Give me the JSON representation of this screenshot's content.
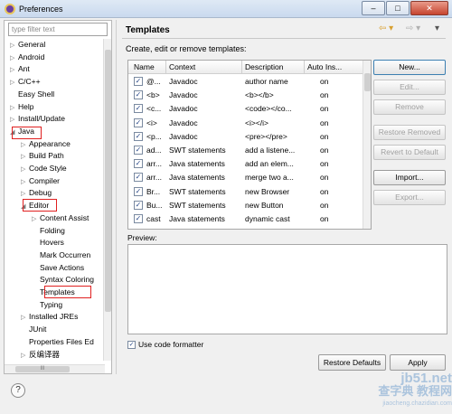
{
  "window": {
    "title": "Preferences",
    "min": "–",
    "max": "□",
    "close": "✕"
  },
  "sidebar": {
    "filter_placeholder": "type filter text",
    "items": [
      {
        "label": "General",
        "indent": 0,
        "twisty": "▷"
      },
      {
        "label": "Android",
        "indent": 0,
        "twisty": "▷"
      },
      {
        "label": "Ant",
        "indent": 0,
        "twisty": "▷"
      },
      {
        "label": "C/C++",
        "indent": 0,
        "twisty": "▷"
      },
      {
        "label": "Easy Shell",
        "indent": 0,
        "twisty": ""
      },
      {
        "label": "Help",
        "indent": 0,
        "twisty": "▷"
      },
      {
        "label": "Install/Update",
        "indent": 0,
        "twisty": "▷"
      },
      {
        "label": "Java",
        "indent": 0,
        "twisty": "◢"
      },
      {
        "label": "Appearance",
        "indent": 1,
        "twisty": "▷"
      },
      {
        "label": "Build Path",
        "indent": 1,
        "twisty": "▷"
      },
      {
        "label": "Code Style",
        "indent": 1,
        "twisty": "▷"
      },
      {
        "label": "Compiler",
        "indent": 1,
        "twisty": "▷"
      },
      {
        "label": "Debug",
        "indent": 1,
        "twisty": "▷"
      },
      {
        "label": "Editor",
        "indent": 1,
        "twisty": "◢"
      },
      {
        "label": "Content Assist",
        "indent": 2,
        "twisty": "▷"
      },
      {
        "label": "Folding",
        "indent": 2,
        "twisty": ""
      },
      {
        "label": "Hovers",
        "indent": 2,
        "twisty": ""
      },
      {
        "label": "Mark Occurren",
        "indent": 2,
        "twisty": ""
      },
      {
        "label": "Save Actions",
        "indent": 2,
        "twisty": ""
      },
      {
        "label": "Syntax Coloring",
        "indent": 2,
        "twisty": ""
      },
      {
        "label": "Templates",
        "indent": 2,
        "twisty": ""
      },
      {
        "label": "Typing",
        "indent": 2,
        "twisty": ""
      },
      {
        "label": "Installed JREs",
        "indent": 1,
        "twisty": "▷"
      },
      {
        "label": "JUnit",
        "indent": 1,
        "twisty": ""
      },
      {
        "label": "Properties Files Ed",
        "indent": 1,
        "twisty": ""
      },
      {
        "label": "反编译器",
        "indent": 1,
        "twisty": "▷"
      }
    ],
    "hscroll_grip": "III"
  },
  "main": {
    "title": "Templates",
    "nav_back": "⇦ ▾",
    "nav_fwd": "⇨ ▾",
    "nav_menu": "▾",
    "description": "Create, edit or remove templates:",
    "columns": [
      "Name",
      "Context",
      "Description",
      "Auto Ins..."
    ],
    "rows": [
      {
        "name": "@...",
        "context": "Javadoc",
        "description": "author name",
        "auto": "on"
      },
      {
        "name": "<b>",
        "context": "Javadoc",
        "description": "<b></b>",
        "auto": "on"
      },
      {
        "name": "<c...",
        "context": "Javadoc",
        "description": "<code></co...",
        "auto": "on"
      },
      {
        "name": "<i>",
        "context": "Javadoc",
        "description": "<i></i>",
        "auto": "on"
      },
      {
        "name": "<p...",
        "context": "Javadoc",
        "description": "<pre></pre>",
        "auto": "on"
      },
      {
        "name": "ad...",
        "context": "SWT statements",
        "description": "add a listene...",
        "auto": "on"
      },
      {
        "name": "arr...",
        "context": "Java statements",
        "description": "add an elem...",
        "auto": "on"
      },
      {
        "name": "arr...",
        "context": "Java statements",
        "description": "merge two a...",
        "auto": "on"
      },
      {
        "name": "Br...",
        "context": "SWT statements",
        "description": "new Browser",
        "auto": "on"
      },
      {
        "name": "Bu...",
        "context": "SWT statements",
        "description": "new Button",
        "auto": "on"
      },
      {
        "name": "cast",
        "context": "Java statements",
        "description": "dynamic cast",
        "auto": "on"
      }
    ],
    "buttons": {
      "new": "New...",
      "edit": "Edit...",
      "remove": "Remove",
      "restore_removed": "Restore Removed",
      "revert_default": "Revert to Default",
      "import": "Import...",
      "export": "Export..."
    },
    "preview_label": "Preview:",
    "code_formatter_label": "Use code formatter",
    "restore_defaults": "Restore Defaults",
    "apply": "Apply"
  },
  "footer": {
    "help": "?"
  },
  "watermark": {
    "line1": "jb51.net",
    "line2": "查字典 教程网",
    "line3": "jiaocheng.chazidian.com"
  }
}
